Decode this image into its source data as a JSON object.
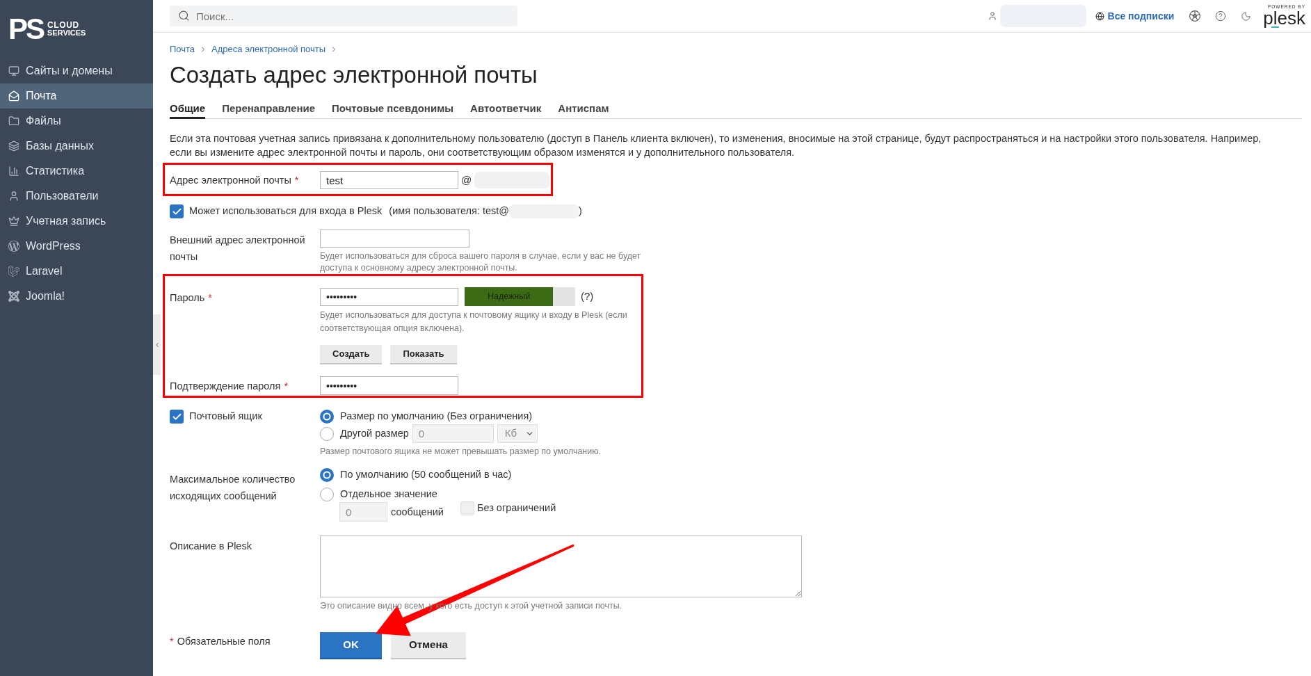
{
  "sidebar": {
    "logo": {
      "mark": "PS",
      "line_1": "CLOUD",
      "line_2": "SERVICES"
    },
    "items": [
      {
        "label": "Сайты и домены",
        "selected": false
      },
      {
        "label": "Почта",
        "selected": true
      },
      {
        "label": "Файлы",
        "selected": false
      },
      {
        "label": "Базы данных",
        "selected": false
      },
      {
        "label": "Статистика",
        "selected": false
      },
      {
        "label": "Пользователи",
        "selected": false
      },
      {
        "label": "Учетная запись",
        "selected": false
      },
      {
        "label": "WordPress",
        "selected": false
      },
      {
        "label": "Laravel",
        "selected": false
      },
      {
        "label": "Joomla!",
        "selected": false
      }
    ]
  },
  "top_bar": {
    "search": {
      "placeholder": "Поиск..."
    },
    "subscriptions_link": "Все подписки",
    "logo": {
      "tagline": "POWERED BY",
      "wordmark": "plesk"
    }
  },
  "breadcrumbs": [
    "Почта",
    "Адреса электронной почты"
  ],
  "title": "Создать адрес электронной почты",
  "tabs": [
    {
      "label": "Общие",
      "selected": true
    },
    {
      "label": "Перенаправление",
      "selected": false
    },
    {
      "label": "Почтовые псевдонимы",
      "selected": false
    },
    {
      "label": "Автоответчик",
      "selected": false
    },
    {
      "label": "Антиспам",
      "selected": false
    }
  ],
  "intro": "Если эта почтовая учетная запись привязана к дополнительному пользователю (доступ в Панель клиента включен), то изменения, вносимые на этой странице, будут распространяться и на настройки этого пользователя. Например, если вы измените адрес электронной почты и пароль, они соответствующим образом изменятся и у дополнительного пользователя.",
  "form": {
    "email": {
      "label": "Адрес электронной почты",
      "required_mark": "*",
      "value": "test",
      "separator": "@",
      "highlighted": true
    },
    "login": {
      "label": "Может использоваться для входа в Plesk",
      "note_start": "(имя пользователя: test@",
      "note_end": ")",
      "checked": true
    },
    "external_email": {
      "label": "Внешний адрес электронной почты",
      "hint": "Будет использоваться для сброса вашего пароля в случае, если у вас не будет доступа к основному адресу электронной почты."
    },
    "password": {
      "highlighted": true,
      "label": "Пароль",
      "required_mark": "*",
      "value": "•••••••••",
      "strength": {
        "label": "Надежный",
        "level": 0.8
      },
      "help": "(?)",
      "hint": "Будет использоваться для доступа к почтовому ящику и входу в Plesk (если соответствующая опция включена).",
      "buttons": [
        "Создать",
        "Показать"
      ],
      "confirm": {
        "label": "Подтверждение пароля",
        "required_mark": "*",
        "value": "•••••••••"
      }
    },
    "mailbox": {
      "label": "Почтовый ящик",
      "checked": true,
      "options": [
        {
          "label": "Размер по умолчанию (Без ограничения)",
          "selected": true
        },
        {
          "label": "Другой размер",
          "selected": false,
          "amount": {
            "value": "0",
            "disabled": true
          },
          "unit": {
            "value": "Кб",
            "disabled": true
          }
        }
      ],
      "hint": "Размер почтового ящика не может превышать размер по умолчанию."
    },
    "outgoing": {
      "label": "Максимальное количество исходящих сообщений",
      "options": [
        {
          "label": "По умолчанию (50 сообщений в час)",
          "selected": true
        },
        {
          "label": "Отдельное значение",
          "selected": false,
          "amount": {
            "value": "0",
            "disabled": true
          },
          "unit_label": "сообщений",
          "unlimited": {
            "label": "Без ограничений",
            "checked": false
          }
        }
      ]
    },
    "description": {
      "label": "Описание в Plesk",
      "hint": "Это описание видно всем, у кого есть доступ к этой учетной записи почты."
    },
    "footer": {
      "required_mark": "*",
      "required_note": "Обязательные поля",
      "buttons": [
        {
          "label": "OK",
          "kind": "primary"
        },
        {
          "label": "Отмена",
          "kind": "secondary"
        }
      ]
    }
  }
}
